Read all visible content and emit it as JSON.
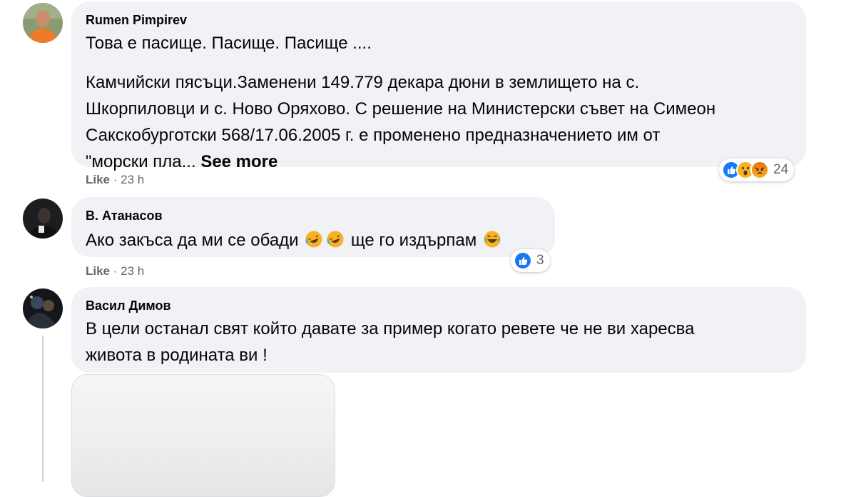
{
  "comments": [
    {
      "author": "Rumen Pimpirev",
      "lines": [
        "Това е пасище. Пасище. Пасище ....",
        "Камчийски пясъци.Заменени 149.779 декара дюни в землището на с.",
        "Шкорпиловци и с. Ново Оряхово. С решение на Министерски съвет на Симеон",
        "Сакскобурготски 568/17.06.2005 г. е променено предназначението им от",
        "\"морски пла..."
      ],
      "see_more": "See more",
      "like": "Like",
      "time": "23 h",
      "reaction_count": "24",
      "reactions": [
        "like-icon",
        "wow-icon",
        "angry-icon"
      ]
    },
    {
      "author": "В. Атанасов",
      "text_part1": "Ако закъса да ми се обади",
      "text_part2": "ще го издърпам",
      "like": "Like",
      "time": "23 h",
      "reaction_count": "3",
      "reactions": [
        "like-icon"
      ]
    },
    {
      "author": "Васил Димов",
      "lines": [
        "В цели останал свят който давате за пример когато ревете че не ви харесва",
        "живота в родината ви !"
      ]
    }
  ],
  "separator": "·",
  "colors": {
    "bubble": "#f0f2f5",
    "meta_text": "#65676b",
    "like_blue": "#1877f2",
    "emoji_yellow": "#f7b125"
  }
}
